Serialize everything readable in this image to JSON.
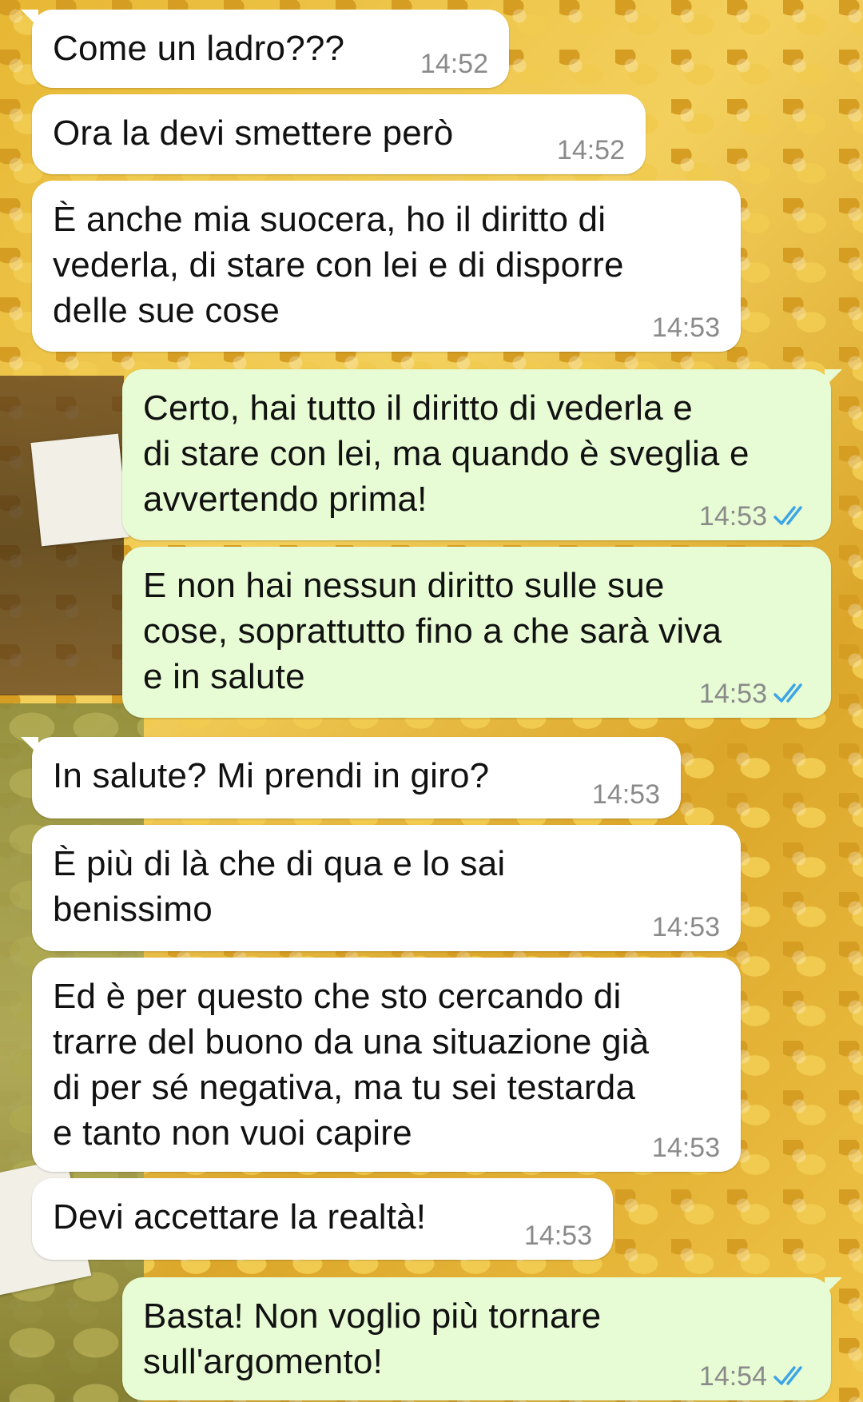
{
  "theme": {
    "incoming_bubble": "#ffffff",
    "outgoing_bubble": "#e7fcd4",
    "timestamp_color": "#8a8a8a",
    "read_tick_color": "#3da5e6"
  },
  "messages": [
    {
      "direction": "in",
      "text": "Come un ladro???",
      "time": "14:52"
    },
    {
      "direction": "in",
      "text": "Ora la devi smettere però",
      "time": "14:52"
    },
    {
      "direction": "in",
      "text": "È anche mia suocera, ho il diritto di\nvederla, di stare con lei e di disporre\ndelle sue cose",
      "time": "14:53"
    },
    {
      "direction": "out",
      "text": "Certo, hai tutto il diritto di vederla e\ndi stare con lei, ma quando è sveglia e\navvertendo prima!",
      "time": "14:53",
      "status": "read"
    },
    {
      "direction": "out",
      "text": "E non hai nessun diritto sulle sue\ncose, soprattutto fino a che sarà viva\ne in salute",
      "time": "14:53",
      "status": "read"
    },
    {
      "direction": "in",
      "text": "In salute? Mi prendi in giro?",
      "time": "14:53"
    },
    {
      "direction": "in",
      "text": "È più di là che di qua e lo sai\nbenissimo",
      "time": "14:53"
    },
    {
      "direction": "in",
      "text": "Ed è per questo che sto cercando di\ntrarre del buono da una situazione già\ndi per sé negativa, ma tu sei testarda\ne tanto non vuoi capire",
      "time": "14:53"
    },
    {
      "direction": "in",
      "text": "Devi accettare la realtà!",
      "time": "14:53"
    },
    {
      "direction": "out",
      "text": "Basta! Non voglio più tornare\nsull'argomento!",
      "time": "14:54",
      "status": "read"
    }
  ]
}
